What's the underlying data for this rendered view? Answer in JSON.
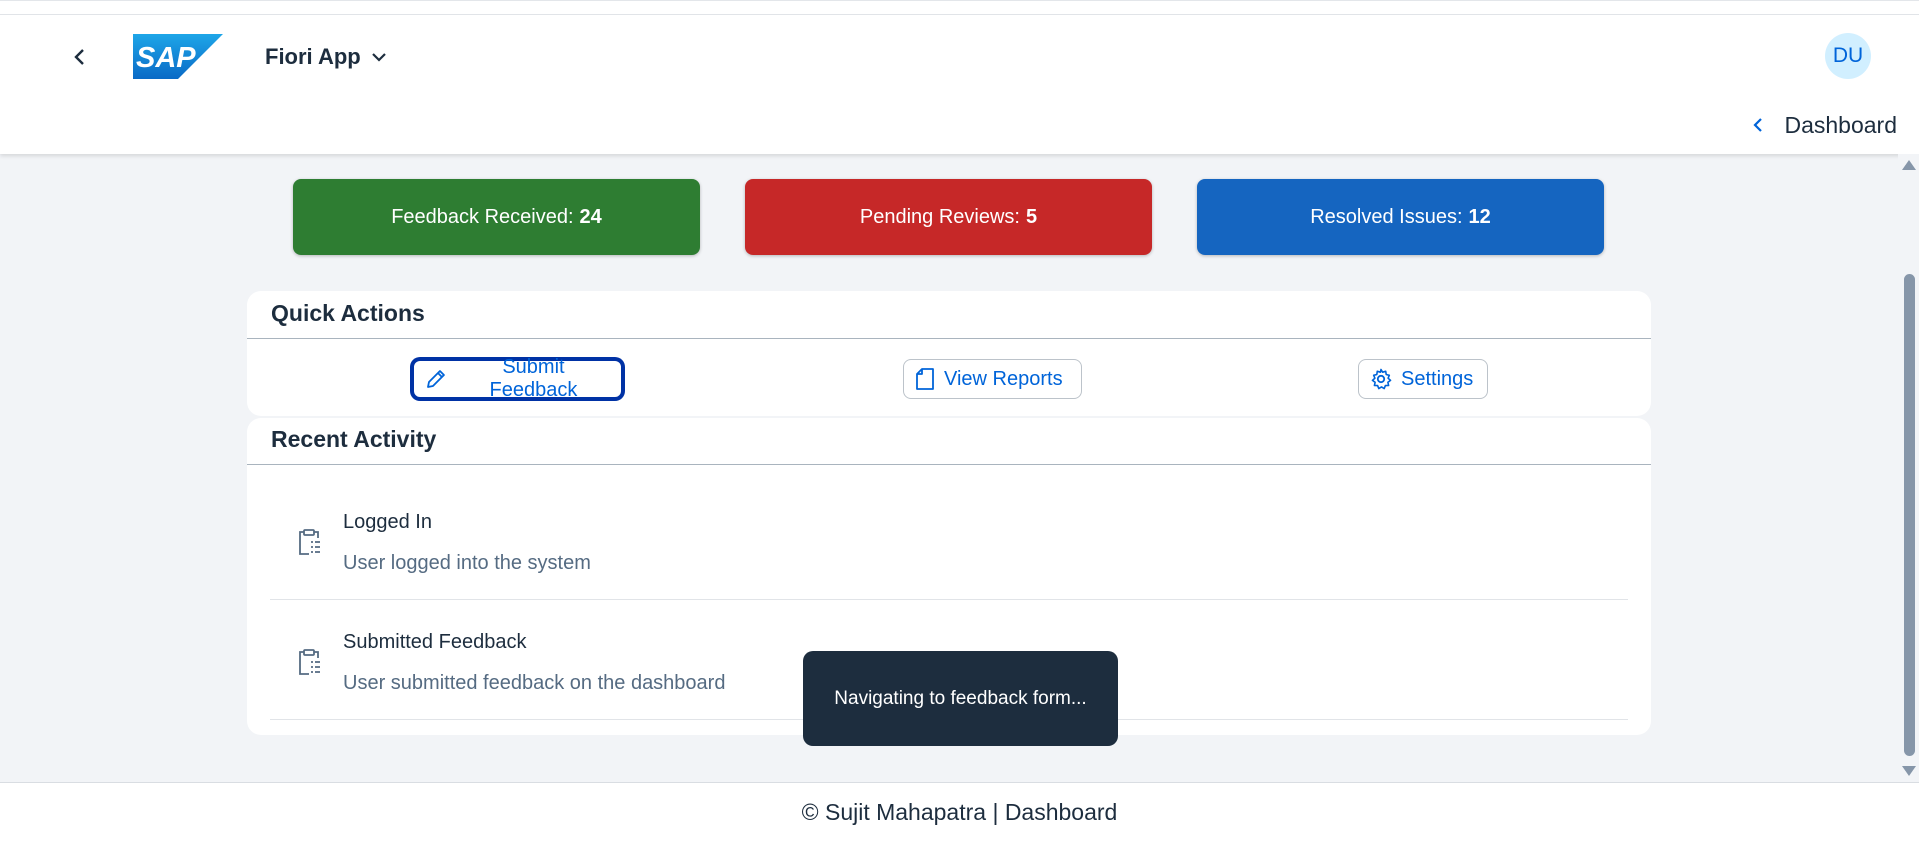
{
  "header": {
    "back_icon": "chevron-left-icon",
    "logo_text": "SAP",
    "app_title": "Fiori App",
    "app_title_icon": "chevron-down-icon",
    "avatar_initials": "DU",
    "subnav_icon": "chevron-left-icon",
    "subnav_label": "Dashboard"
  },
  "kpis": [
    {
      "label": "Feedback Received:",
      "value": "24",
      "color": "#2e7d32"
    },
    {
      "label": "Pending Reviews:",
      "value": "5",
      "color": "#c62828"
    },
    {
      "label": "Resolved Issues:",
      "value": "12",
      "color": "#1565c0"
    }
  ],
  "quick_actions": {
    "title": "Quick Actions",
    "buttons": [
      {
        "label": "Submit Feedback",
        "icon": "pencil-icon"
      },
      {
        "label": "View Reports",
        "icon": "document-icon"
      },
      {
        "label": "Settings",
        "icon": "gear-icon"
      }
    ]
  },
  "recent_activity": {
    "title": "Recent Activity",
    "items": [
      {
        "title": "Logged In",
        "description": "User logged into the system",
        "icon": "clipboard-list-icon"
      },
      {
        "title": "Submitted Feedback",
        "description": "User submitted feedback on the dashboard",
        "icon": "clipboard-list-icon"
      }
    ]
  },
  "toast": {
    "message": "Navigating to feedback form..."
  },
  "footer": {
    "text": "© Sujit Mahapatra | Dashboard"
  },
  "colors": {
    "accent": "#0064d9",
    "shell_text": "#1d2d3e",
    "toast_bg": "#1d2d3e"
  }
}
